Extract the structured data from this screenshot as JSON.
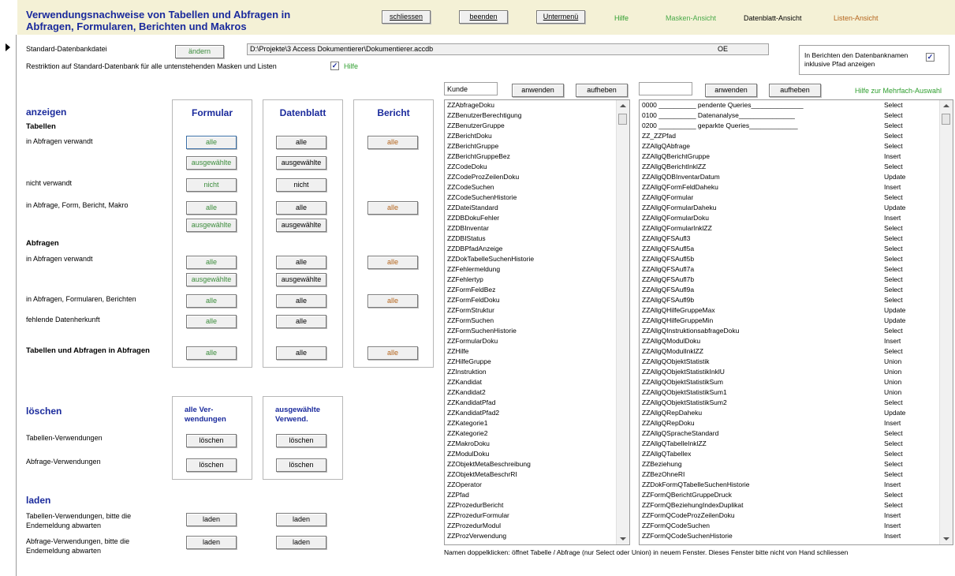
{
  "header": {
    "title_line1": "Verwendungsnachweise von Tabellen und Abfragen in",
    "title_line2": "Abfragen, Formularen, Berichten und Makros",
    "buttons": {
      "schliessen": "schliessen",
      "beenden": "beenden",
      "untermenue": "Untermenü"
    },
    "links": {
      "hilfe": "Hilfe",
      "masken": "Masken-Ansicht",
      "datenblatt": "Datenblatt-Ansicht",
      "listen": "Listen-Ansicht"
    },
    "colors": {
      "hilfe": "#2e9e2e",
      "masken": "#4aaa4a",
      "datenblatt": "#000000",
      "listen": "#b5651d"
    }
  },
  "std_db": {
    "label": "Standard-Datenbankdatei",
    "change_button": "ändern",
    "path": "D:\\Projekte\\3 Access Dokumentierer\\Dokumentierer.accdb",
    "oe": "OE",
    "restriction_label": "Restriktion auf Standard-Datenbank für alle untenstehenden Masken und Listen",
    "restriction_checked": true,
    "hilfe_link": "Hilfe",
    "report_option_label": "In Berichten den Datenbanknamen inklusive Pfad anzeigen",
    "report_option_checked": true
  },
  "filters": {
    "left_value": "Kunde",
    "right_value": "",
    "apply": "anwenden",
    "cancel": "aufheben",
    "multi_help": "Hilfe zur Mehrfach-Auswahl"
  },
  "anzeigen": {
    "title": "anzeigen",
    "col_formular": "Formular",
    "col_datenblatt": "Datenblatt",
    "col_bericht": "Bericht",
    "tabellen_heading": "Tabellen",
    "abfragen_heading": "Abfragen",
    "rows": {
      "in_abfragen": "in Abfragen verwandt",
      "nicht_verwandt": "nicht verwandt",
      "in_afbm": "in Abfrage, Form, Bericht, Makro",
      "abf_in_abfragen": "in Abfragen verwandt",
      "abf_in_afb": "in Abfragen, Formularen, Berichten",
      "fehlende": "fehlende Datenherkunft",
      "tab_und_abf": "Tabellen und Abfragen in Abfragen"
    },
    "btn": {
      "alle": "alle",
      "ausgewaehlte": "ausgewählte",
      "nicht": "nicht"
    }
  },
  "loeschen": {
    "title": "löschen",
    "col_alle": "alle Ver-\nwendungen",
    "col_alle_l1": "alle Ver-",
    "col_alle_l2": "wendungen",
    "col_ausg_l1": "ausgewählte",
    "col_ausg_l2": "Verwend.",
    "tab_label": "Tabellen-Verwendungen",
    "abf_label": "Abfrage-Verwendungen",
    "btn": "löschen"
  },
  "laden": {
    "title": "laden",
    "tab_label_l1": "Tabellen-Verwendungen, bitte die",
    "tab_label_l2": "Endemeldung abwarten",
    "abf_label_l1": "Abfrage-Verwendungen, bitte die",
    "abf_label_l2": "Endemeldung abwarten",
    "btn": "laden"
  },
  "left_list": [
    "ZZAbfrageDoku",
    "ZZBenutzerBerechtigung",
    "ZZBenutzerGruppe",
    "ZZBerichtDoku",
    "ZZBerichtGruppe",
    "ZZBerichtGruppeBez",
    "ZZCodeDoku",
    "ZZCodeProzZeilenDoku",
    "ZZCodeSuchen",
    "ZZCodeSuchenHistorie",
    "ZZDateiStandard",
    "ZZDBDokuFehler",
    "ZZDBInventar",
    "ZZDBIStatus",
    "ZZDBPfadAnzeige",
    "ZZDokTabelleSuchenHistorie",
    "ZZFehlermeldung",
    "ZZFehlertyp",
    "ZZFormFeldBez",
    "ZZFormFeldDoku",
    "ZZFormStruktur",
    "ZZFormSuchen",
    "ZZFormSuchenHistorie",
    "ZZFormularDoku",
    "ZZHilfe",
    "ZZHilfeGruppe",
    "ZZInstruktion",
    "ZZKandidat",
    "ZZKandidat2",
    "ZZKandidatPfad",
    "ZZKandidatPfad2",
    "ZZKategorie1",
    "ZZKategorie2",
    "ZZMakroDoku",
    "ZZModulDoku",
    "ZZObjektMetaBeschreibung",
    "ZZObjektMetaBeschrRI",
    "ZZOperator",
    "ZZPfad",
    "ZZProzedurBericht",
    "ZZProzedurFormular",
    "ZZProzedurModul",
    "ZZProzVerwendung"
  ],
  "right_list": [
    {
      "name": "0000 __________ pendente Queries______________",
      "type": "Select"
    },
    {
      "name": "0100 __________ Datenanalyse_______________",
      "type": "Select"
    },
    {
      "name": "0200 __________ geparkte Queries_____________",
      "type": "Select"
    },
    {
      "name": "ZZ_ZZPfad",
      "type": "Select"
    },
    {
      "name": "ZZAllgQAbfrage",
      "type": "Select"
    },
    {
      "name": "ZZAllgQBerichtGruppe",
      "type": "Insert"
    },
    {
      "name": "ZZAllgQBerichtInklZZ",
      "type": "Select"
    },
    {
      "name": "ZZAllgQDBInventarDatum",
      "type": "Update"
    },
    {
      "name": "ZZAllgQFormFeldDaheku",
      "type": "Insert"
    },
    {
      "name": "ZZAllgQFormular",
      "type": "Select"
    },
    {
      "name": "ZZAllgQFormularDaheku",
      "type": "Update"
    },
    {
      "name": "ZZAllgQFormularDoku",
      "type": "Insert"
    },
    {
      "name": "ZZAllgQFormularInklZZ",
      "type": "Select"
    },
    {
      "name": "ZZAllgQFSAufl3",
      "type": "Select"
    },
    {
      "name": "ZZAllgQFSAufl5a",
      "type": "Select"
    },
    {
      "name": "ZZAllgQFSAufl5b",
      "type": "Select"
    },
    {
      "name": "ZZAllgQFSAufl7a",
      "type": "Select"
    },
    {
      "name": "ZZAllgQFSAufl7b",
      "type": "Select"
    },
    {
      "name": "ZZAllgQFSAufl9a",
      "type": "Select"
    },
    {
      "name": "ZZAllgQFSAufl9b",
      "type": "Select"
    },
    {
      "name": "ZZAllgQHilfeGruppeMax",
      "type": "Update"
    },
    {
      "name": "ZZAllgQHilfeGruppeMin",
      "type": "Update"
    },
    {
      "name": "ZZAllgQInstruktionsabfrageDoku",
      "type": "Select"
    },
    {
      "name": "ZZAllgQModulDoku",
      "type": "Insert"
    },
    {
      "name": "ZZAllgQModulInklZZ",
      "type": "Select"
    },
    {
      "name": "ZZAllgQObjektStatistik",
      "type": "Union"
    },
    {
      "name": "ZZAllgQObjektStatistikInklU",
      "type": "Union"
    },
    {
      "name": "ZZAllgQObjektStatistikSum",
      "type": "Union"
    },
    {
      "name": "ZZAllgQObjektStatistikSum1",
      "type": "Union"
    },
    {
      "name": "ZZAllgQObjektStatistikSum2",
      "type": "Select"
    },
    {
      "name": "ZZAllgQRepDaheku",
      "type": "Update"
    },
    {
      "name": "ZZAllgQRepDoku",
      "type": "Insert"
    },
    {
      "name": "ZZAllgQSpracheStandard",
      "type": "Select"
    },
    {
      "name": "ZZAllgQTabelleInklZZ",
      "type": "Select"
    },
    {
      "name": "ZZAllgQTabellex",
      "type": "Select"
    },
    {
      "name": "ZZBeziehung",
      "type": "Select"
    },
    {
      "name": "ZZBezOhneRI",
      "type": "Select"
    },
    {
      "name": "ZZDokFormQTabelleSuchenHistorie",
      "type": "Insert"
    },
    {
      "name": "ZZFormQBerichtGruppeDruck",
      "type": "Select"
    },
    {
      "name": "ZZFormQBeziehungIndexDuplikat",
      "type": "Select"
    },
    {
      "name": "ZZFormQCodeProzZeilenDoku",
      "type": "Insert"
    },
    {
      "name": "ZZFormQCodeSuchen",
      "type": "Insert"
    },
    {
      "name": "ZZFormQCodeSuchenHistorie",
      "type": "Insert"
    }
  ],
  "footer_note": "Namen doppelklicken: öffnet Tabelle / Abfrage (nur Select oder Union) in neuem Fenster. Dieses Fenster bitte nicht von Hand schliessen"
}
